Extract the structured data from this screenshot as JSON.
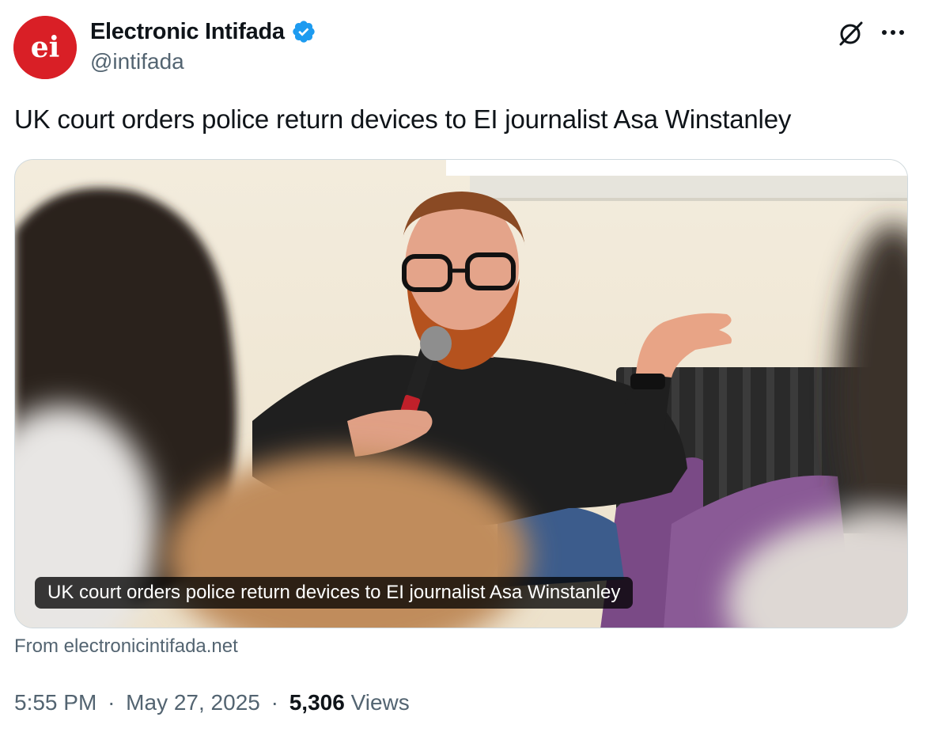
{
  "author": {
    "display_name": "Electronic Intifada",
    "handle": "@intifada",
    "avatar_text": "ei",
    "verified": true,
    "avatar_color": "#d91f26",
    "verified_color": "#1d9bf0"
  },
  "header_actions": {
    "grok_icon": "grok-icon",
    "more_icon": "more-horizontal-icon"
  },
  "tweet": {
    "text": "UK court orders police return devices to EI journalist Asa Winstanley"
  },
  "link_card": {
    "caption": "UK court orders police return devices to EI journalist Asa Winstanley",
    "source": "From electronicintifada.net"
  },
  "meta": {
    "time": "5:55 PM",
    "separator": "·",
    "date": "May 27, 2025",
    "views_count": "5,306",
    "views_label": "Views"
  },
  "colors": {
    "text_primary": "#0f1419",
    "text_secondary": "#536471",
    "border": "#cfd9de"
  }
}
